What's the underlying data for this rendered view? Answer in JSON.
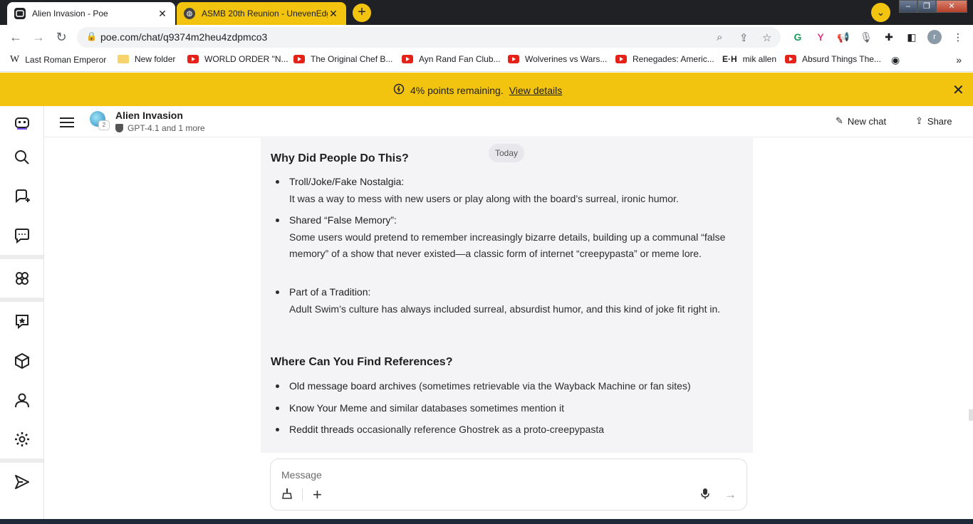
{
  "browser": {
    "tabs": [
      {
        "title": "Alien Invasion - Poe",
        "active": true
      },
      {
        "title": "ASMB 20th Reunion - UnevenEdge",
        "active": false
      }
    ],
    "url": "poe.com/chat/q9374m2heu4zdpmco3",
    "bookmarks": [
      {
        "label": "Last Roman Emperor",
        "icon": "wikipedia-icon"
      },
      {
        "label": "New folder",
        "icon": "folder-icon"
      },
      {
        "label": "WORLD ORDER \"N...",
        "icon": "youtube-icon"
      },
      {
        "label": "The Original Chef B...",
        "icon": "youtube-icon"
      },
      {
        "label": "Ayn Rand Fan Club...",
        "icon": "youtube-icon"
      },
      {
        "label": "Wolverines vs Wars...",
        "icon": "youtube-icon"
      },
      {
        "label": "Renegades: Americ...",
        "icon": "youtube-icon"
      },
      {
        "label": "mik allen",
        "icon": "eh-icon"
      },
      {
        "label": "Absurd Things The...",
        "icon": "youtube-icon"
      }
    ],
    "profile_initial": "r"
  },
  "banner": {
    "text": "4% points remaining.",
    "link": "View details",
    "color": "#f2c40f"
  },
  "header": {
    "bot_name": "Alien Invasion",
    "bot_count": "2",
    "subtitle": "GPT-4.1 and 1 more",
    "new_chat": "New chat",
    "share": "Share"
  },
  "chat": {
    "date_label": "Today",
    "section1_title": "Why Did People Do This?",
    "section1_items": [
      {
        "title": "Troll/Joke/Fake Nostalgia:",
        "body": "It was a way to mess with new users or play along with the board’s surreal, ironic humor."
      },
      {
        "title": "Shared “False Memory”:",
        "body": "Some users would pretend to remember increasingly bizarre details, building up a communal “false memory” of a show that never existed—a classic form of internet “creepypasta” or meme lore."
      },
      {
        "title": "Part of a Tradition:",
        "body": "Adult Swim’s culture has always included surreal, absurdist humor, and this kind of joke fit right in."
      }
    ],
    "section2_title": "Where Can You Find References?",
    "section2_items": [
      {
        "title": "Old message board archives",
        "body": " (sometimes retrievable via the Wayback Machine or fan sites)"
      },
      {
        "title": "Know Your Meme",
        "body": " and similar databases sometimes mention it"
      },
      {
        "title": "Reddit threads",
        "body": " occasionally reference Ghostrek as a proto-creepypasta"
      }
    ]
  },
  "composer": {
    "placeholder": "Message"
  }
}
